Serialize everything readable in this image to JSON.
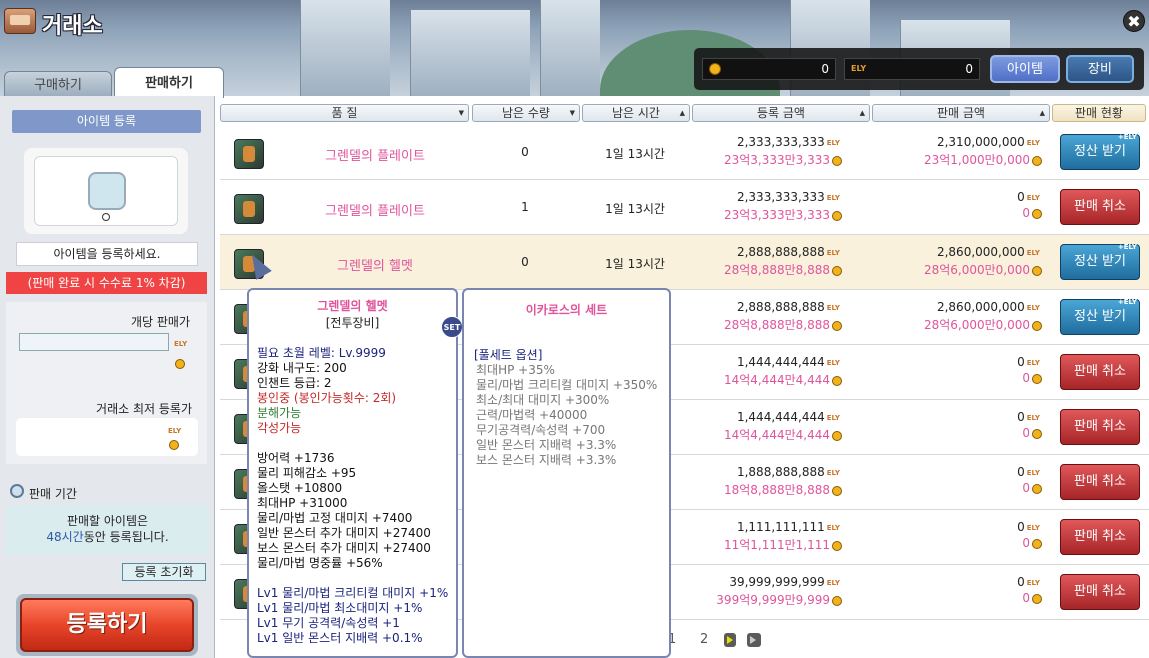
{
  "window": {
    "title": "거래소",
    "close": "✖"
  },
  "currency": {
    "meso": "0",
    "ely": "0",
    "ely_label": "ELY"
  },
  "header_buttons": {
    "item": "아이템",
    "equip": "장비"
  },
  "tabs": {
    "buy": "구매하기",
    "sell": "판매하기"
  },
  "left": {
    "register_header": "아이템 등록",
    "register_msg": "아이템을 등록하세요.",
    "fee_msg": "(판매 완료 시 수수료 1% 차감)",
    "unit_price_label": "개당 판매가",
    "min_price_label": "거래소 최저 등록가",
    "period_label": "판매 기간",
    "period_line1": "판매할 아이템은",
    "period_hours": "48시간",
    "period_line2_rest": "동안 등록됩니다.",
    "reset_button": "등록 초기화",
    "register_button": "등록하기",
    "ely_label": "ELY"
  },
  "table": {
    "headers": {
      "grade": "품 질",
      "qty": "남은 수량",
      "time": "남은 시간",
      "reg_price": "등록 금액",
      "sale_price": "판매 금액",
      "status": "판매 현황"
    },
    "ely_label": "ELY",
    "rows": [
      {
        "name": "그렌델의 플레이트",
        "qty": "0",
        "time": "1일 13시간",
        "reg": "2,333,333,333",
        "reg_kr": "23억3,333만3,333",
        "sale": "2,310,000,000",
        "sale_kr": "23억1,000만0,000",
        "action": "정산 받기",
        "type": "settle"
      },
      {
        "name": "그렌델의 플레이트",
        "qty": "1",
        "time": "1일 13시간",
        "reg": "2,333,333,333",
        "reg_kr": "23억3,333만3,333",
        "sale": "0",
        "sale_kr": "0",
        "action": "판매 취소",
        "type": "cancel"
      },
      {
        "name": "그렌델의 헬멧",
        "qty": "0",
        "time": "1일 13시간",
        "reg": "2,888,888,888",
        "reg_kr": "28억8,888만8,888",
        "sale": "2,860,000,000",
        "sale_kr": "28억6,000만0,000",
        "action": "정산 받기",
        "type": "settle"
      },
      {
        "name": "",
        "qty": "",
        "time": "",
        "reg": "2,888,888,888",
        "reg_kr": "28억8,888만8,888",
        "sale": "2,860,000,000",
        "sale_kr": "28억6,000만0,000",
        "action": "정산 받기",
        "type": "settle"
      },
      {
        "name": "",
        "qty": "",
        "time": "",
        "reg": "1,444,444,444",
        "reg_kr": "14억4,444만4,444",
        "sale": "0",
        "sale_kr": "0",
        "action": "판매 취소",
        "type": "cancel"
      },
      {
        "name": "",
        "qty": "",
        "time": "",
        "reg": "1,444,444,444",
        "reg_kr": "14억4,444만4,444",
        "sale": "0",
        "sale_kr": "0",
        "action": "판매 취소",
        "type": "cancel"
      },
      {
        "name": "",
        "qty": "",
        "time": "",
        "reg": "1,888,888,888",
        "reg_kr": "18억8,888만8,888",
        "sale": "0",
        "sale_kr": "0",
        "action": "판매 취소",
        "type": "cancel"
      },
      {
        "name": "",
        "qty": "",
        "time": "",
        "reg": "1,111,111,111",
        "reg_kr": "11억1,111만1,111",
        "sale": "0",
        "sale_kr": "0",
        "action": "판매 취소",
        "type": "cancel"
      },
      {
        "name": "",
        "qty": "",
        "time": "",
        "reg": "39,999,999,999",
        "reg_kr": "399억9,999만9,999",
        "sale": "0",
        "sale_kr": "0",
        "action": "판매 취소",
        "type": "cancel"
      }
    ],
    "action_badge": "+ELY"
  },
  "pager": {
    "page1": "1",
    "page2": "2"
  },
  "tooltip_item": {
    "name": "그렌델의 헬멧",
    "category": "[전투장비]",
    "set_badge": "SET",
    "lines": [
      {
        "t": "필요 초월 레벨: Lv.9999",
        "c": "l-navy"
      },
      {
        "t": "강화 내구도: 200",
        "c": "l-black"
      },
      {
        "t": "인챈트 등급: 2",
        "c": "l-black"
      },
      {
        "t": "봉인중 (봉인가능횟수: 2회)",
        "c": "l-red"
      },
      {
        "t": "분해가능",
        "c": "l-green"
      },
      {
        "t": "각성가능",
        "c": "l-red"
      },
      {
        "t": "",
        "c": "gap"
      },
      {
        "t": "방어력 +1736",
        "c": "l-black"
      },
      {
        "t": "물리 피해감소 +95",
        "c": "l-black"
      },
      {
        "t": "올스탯 +10800",
        "c": "l-black"
      },
      {
        "t": "최대HP +31000",
        "c": "l-black"
      },
      {
        "t": "물리/마법 고정 대미지 +7400",
        "c": "l-black"
      },
      {
        "t": "일반 몬스터 추가 대미지 +27400",
        "c": "l-black"
      },
      {
        "t": "보스 몬스터 추가 대미지 +27400",
        "c": "l-black"
      },
      {
        "t": "물리/마법 명중률 +56%",
        "c": "l-black"
      },
      {
        "t": "",
        "c": "gap"
      },
      {
        "t": "Lv1 물리/마법 크리티컬 대미지 +1%",
        "c": "l-navy"
      },
      {
        "t": "Lv1 물리/마법 최소대미지 +1%",
        "c": "l-navy"
      },
      {
        "t": "Lv1 무기 공격력/속성력 +1",
        "c": "l-navy"
      },
      {
        "t": "Lv1 일반 몬스터 지배력 +0.1%",
        "c": "l-navy"
      }
    ]
  },
  "tooltip_set": {
    "name": "이카로스의 세트",
    "lines": [
      {
        "t": "[풀세트 옵션]",
        "c": "l-navy"
      },
      {
        "t": "최대HP +35%",
        "c": "l-gray"
      },
      {
        "t": "물리/마법 크리티컬 대미지 +350%",
        "c": "l-gray"
      },
      {
        "t": "최소/최대 대미지 +300%",
        "c": "l-gray"
      },
      {
        "t": "근력/마법력 +40000",
        "c": "l-gray"
      },
      {
        "t": "무기공격력/속성력 +700",
        "c": "l-gray"
      },
      {
        "t": "일반 몬스터 지배력 +3.3%",
        "c": "l-gray"
      },
      {
        "t": "보스 몬스터 지배력 +3.3%",
        "c": "l-gray"
      }
    ]
  }
}
